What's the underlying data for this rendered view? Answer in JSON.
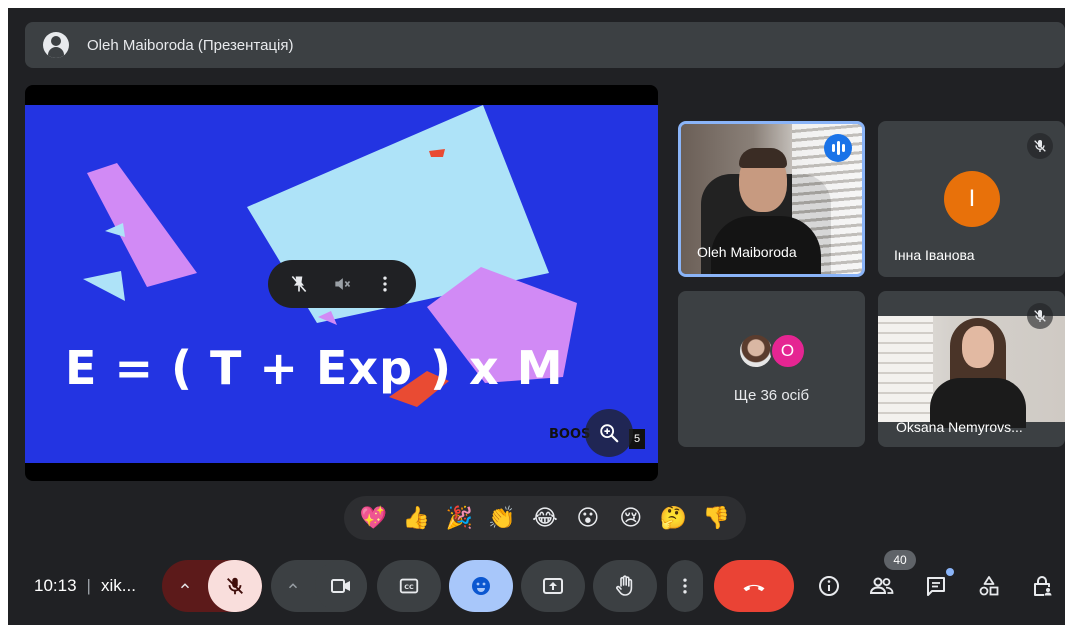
{
  "banner": {
    "presenter": "Oleh Maiboroda (Презентація)"
  },
  "presentation": {
    "formula": "E = ( T + Exp ) x M",
    "logo_text": "BOOS",
    "slide_number": "5",
    "slide_bg": "#2334e2"
  },
  "tiles": [
    {
      "name": "Oleh Maiboroda",
      "speaking": true
    },
    {
      "name": "Інна Іванова",
      "avatar_letter": "I",
      "avatar_color": "#e8710a",
      "muted": true
    },
    {
      "name": "Ще 36 осіб",
      "avatar_letter": "O",
      "avatar_color": "#e52592"
    },
    {
      "name": "Oksana Nemyrovs...",
      "muted": true
    }
  ],
  "reactions": [
    "💖",
    "👍",
    "🎉",
    "👏",
    "😂",
    "😮",
    "😢",
    "🤔",
    "👎"
  ],
  "toolbar": {
    "time": "10:13",
    "separator": "|",
    "meeting_code": "xik...",
    "participants_count": "40",
    "hangup_color": "#ea4335",
    "mic_off_color": "#f9dedc",
    "reactions_active_color": "#a8c7fa"
  }
}
